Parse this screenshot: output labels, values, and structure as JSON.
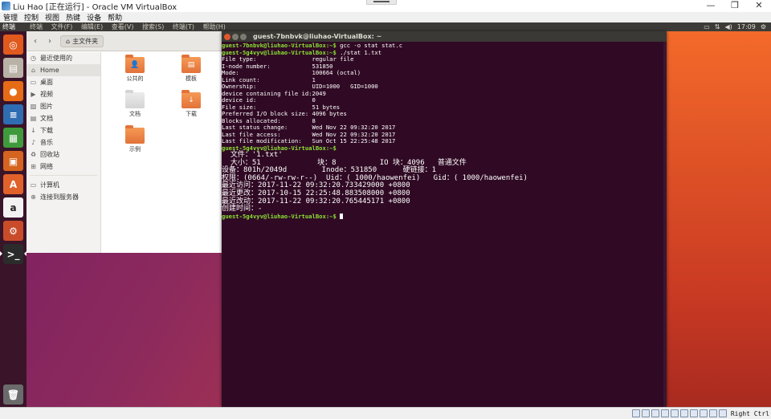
{
  "vbox": {
    "title": "Liu Hao [正在运行] - Oracle VM VirtualBox",
    "window_buttons": [
      "—",
      "❐",
      "✕"
    ],
    "menu": [
      "管理",
      "控制",
      "视图",
      "热键",
      "设备",
      "帮助"
    ],
    "host_key": "Right Ctrl"
  },
  "panel": {
    "app_name": "终端",
    "menus": [
      "终端",
      "文件(F)",
      "编辑(E)",
      "查看(V)",
      "搜索(S)",
      "终端(T)",
      "帮助(H)"
    ],
    "time": "17:09"
  },
  "launcher": {
    "items": [
      {
        "name": "ubuntu-dash-icon",
        "glyph": "◎",
        "color": "#e05a1e"
      },
      {
        "name": "files-icon",
        "glyph": "▤",
        "color": "#b9b2a6"
      },
      {
        "name": "firefox-icon",
        "glyph": "●",
        "color": "#e66b16"
      },
      {
        "name": "writer-icon",
        "glyph": "≡",
        "color": "#2f6db3"
      },
      {
        "name": "calc-icon",
        "glyph": "▦",
        "color": "#3f9a3c"
      },
      {
        "name": "impress-icon",
        "glyph": "▣",
        "color": "#d4641f"
      },
      {
        "name": "software-center-icon",
        "glyph": "A",
        "color": "#e0622a"
      },
      {
        "name": "amazon-icon",
        "glyph": "a",
        "color": "#f2f2f2"
      },
      {
        "name": "settings-icon",
        "glyph": "⚙",
        "color": "#c94c2a"
      },
      {
        "name": "terminal-icon",
        "glyph": ">_",
        "color": "#2b2b2b"
      }
    ],
    "trash_glyph": "🗑"
  },
  "files": {
    "breadcrumb": "主文件夹",
    "sidebar": [
      {
        "label": "最近使用的",
        "glyph": "◷"
      },
      {
        "label": "Home",
        "glyph": "⌂",
        "selected": true
      },
      {
        "label": "桌面",
        "glyph": "▭"
      },
      {
        "label": "视频",
        "glyph": "▶"
      },
      {
        "label": "图片",
        "glyph": "▨"
      },
      {
        "label": "文档",
        "glyph": "▤"
      },
      {
        "label": "下载",
        "glyph": "↓"
      },
      {
        "label": "音乐",
        "glyph": "♪"
      },
      {
        "label": "回收站",
        "glyph": "♻"
      },
      {
        "label": "网络",
        "glyph": "⊞"
      },
      {
        "label": "计算机",
        "glyph": "▭"
      },
      {
        "label": "连接到服务器",
        "glyph": "⊕"
      }
    ],
    "folders": [
      {
        "label": "公共的",
        "glyph": "👤"
      },
      {
        "label": "模板",
        "glyph": "▤"
      },
      {
        "label": "文档",
        "glyph": "",
        "plain": true
      },
      {
        "label": "下载",
        "glyph": "↓"
      },
      {
        "label": "示例",
        "glyph": ""
      }
    ]
  },
  "terminal": {
    "title": "guest-7bnbvk@liuhao-VirtualBox: ~",
    "lines": [
      {
        "prompt": "guest-7bnbvk@liuhao-VirtualBox:~$",
        "text": " gcc -o stat stat.c"
      },
      {
        "prompt": "guest-5g4vyv@liuhao-VirtualBox:~$",
        "text": " ./stat 1.txt"
      },
      {
        "text": "File type:                regular file"
      },
      {
        "text": "I-node number:            531850"
      },
      {
        "text": "Mode:                     100664 (octal)"
      },
      {
        "text": "Link count:               1"
      },
      {
        "text": "Ownership:                UID=1000   GID=1000"
      },
      {
        "text": "device containing file id:2049"
      },
      {
        "text": "device id:                0"
      },
      {
        "text": "File size:                51 bytes"
      },
      {
        "text": "Preferred I/O block size: 4096 bytes"
      },
      {
        "text": "Blocks allocated:         8"
      },
      {
        "text": "Last status change:       Wed Nov 22 09:32:20 2017"
      },
      {
        "text": "Last file access:         Wed Nov 22 09:32:20 2017"
      },
      {
        "text": "Last file modification:   Sun Oct 15 22:25:48 2017"
      },
      {
        "prompt": "guest-5g4vyv@liuhao-VirtualBox:~$",
        "text": ""
      },
      {
        "text": "  文件：'1.txt'",
        "cn": true
      },
      {
        "text": "  大小：51             块：8          IO 块：4096   普通文件",
        "cn": true
      },
      {
        "text": "设备：801h/2049d        Inode：531850      硬链接：1",
        "cn": true
      },
      {
        "text": "权限：(0664/-rw-rw-r--)  Uid：( 1000/haowenfei)   Gid：( 1000/haowenfei)",
        "cn": true
      },
      {
        "text": "最近访问：2017-11-22 09:32:20.733429000 +0800",
        "cn": true
      },
      {
        "text": "最近更改：2017-10-15 22:25:48.883508000 +0800",
        "cn": true
      },
      {
        "text": "最近改动：2017-11-22 09:32:20.765445171 +0800",
        "cn": true
      },
      {
        "text": "创建时间：-",
        "cn": true
      },
      {
        "prompt": "guest-5g4vyv@liuhao-VirtualBox:~$",
        "text": " ",
        "cursor": true
      }
    ]
  }
}
